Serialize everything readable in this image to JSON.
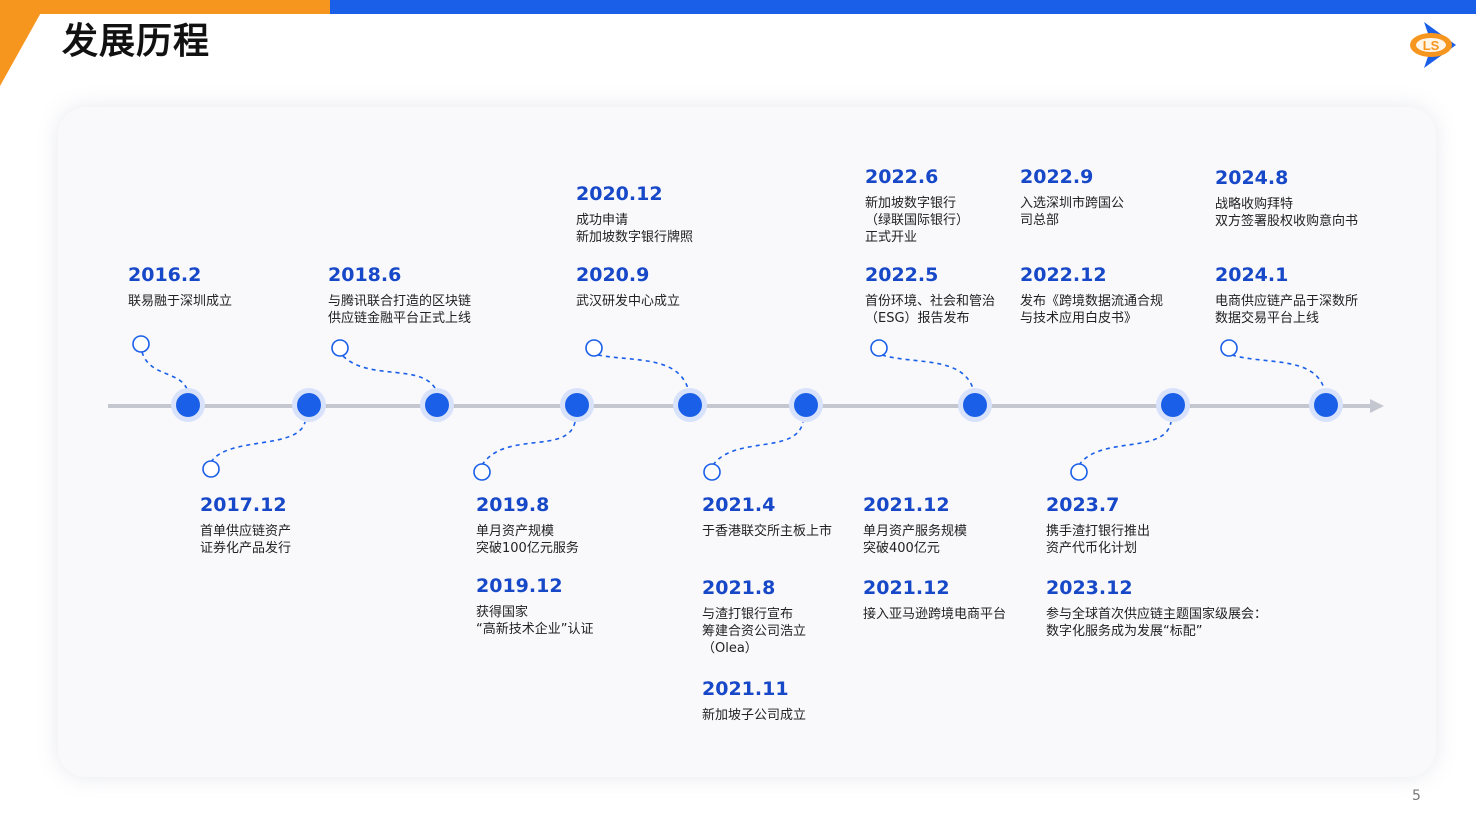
{
  "header": {
    "title": "发展历程"
  },
  "logo": {
    "icon": "company-logo-icon",
    "text": "LS",
    "colors": {
      "orange": "#f7961e",
      "blue": "#1a5fe8"
    }
  },
  "colors": {
    "accent_blue": "#1a5fe8",
    "accent_orange": "#f7961e",
    "date_text": "#1648c8"
  },
  "timeline": {
    "above": [
      {
        "date": "2016.2",
        "desc": "联易融于深圳成立"
      },
      {
        "date": "2018.6",
        "desc": "与腾讯联合打造的区块链\n供应链金融平台正式上线"
      },
      {
        "date": "2020.12",
        "desc": "成功申请\n新加坡数字银行牌照"
      },
      {
        "date": "2020.9",
        "desc": "武汉研发中心成立"
      },
      {
        "date": "2022.6",
        "desc": "新加坡数字银行\n（绿联国际银行）\n正式开业"
      },
      {
        "date": "2022.5",
        "desc": "首份环境、社会和管治\n（ESG）报告发布"
      },
      {
        "date": "2022.9",
        "desc": "入选深圳市跨国公\n司总部"
      },
      {
        "date": "2022.12",
        "desc": "发布《跨境数据流通合规\n与技术应用白皮书》"
      },
      {
        "date": "2024.8",
        "desc": "战略收购拜特\n双方签署股权收购意向书"
      },
      {
        "date": "2024.1",
        "desc": "电商供应链产品于深数所\n数据交易平台上线"
      }
    ],
    "below": [
      {
        "date": "2017.12",
        "desc": "首单供应链资产\n证券化产品发行"
      },
      {
        "date": "2019.8",
        "desc": "单月资产规模\n突破100亿元服务"
      },
      {
        "date": "2019.12",
        "desc": "获得国家\n“高新技术企业”认证"
      },
      {
        "date": "2021.4",
        "desc": "于香港联交所主板上市"
      },
      {
        "date": "2021.8",
        "desc": "与渣打银行宣布\n筹建合资公司浩立\n（Olea）"
      },
      {
        "date": "2021.11",
        "desc": "新加坡子公司成立"
      },
      {
        "date": "2021.12",
        "desc": "单月资产服务规模\n突破400亿元"
      },
      {
        "date": "2021.12",
        "desc": "接入亚马逊跨境电商平台"
      },
      {
        "date": "2023.7",
        "desc": "携手渣打银行推出\n资产代币化计划"
      },
      {
        "date": "2023.12",
        "desc": "参与全球首次供应链主题国家级展会：\n数字化服务成为发展“标配”"
      }
    ]
  },
  "footer": {
    "page_number": "5"
  }
}
